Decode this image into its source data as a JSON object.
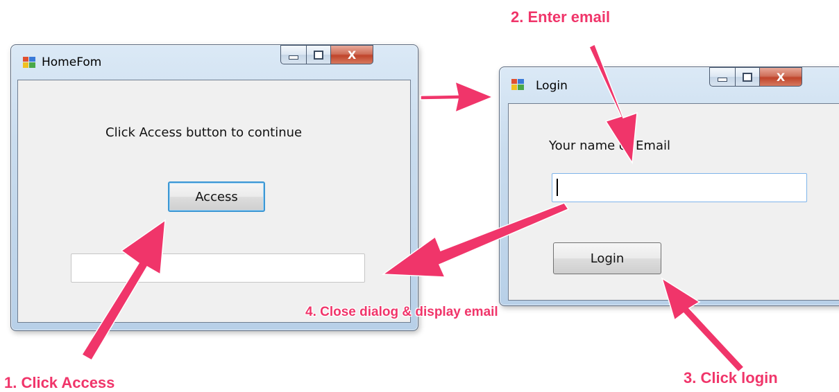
{
  "home_window": {
    "title": "HomeFom",
    "message": "Click Access button to continue",
    "access_button": "Access",
    "result_field_value": "",
    "close_glyph": "X"
  },
  "login_window": {
    "title": "Login",
    "prompt": "Your name or Email",
    "email_field_value": "",
    "login_button": "Login",
    "close_glyph": "X"
  },
  "annotations": {
    "step1": "1. Click Access",
    "step2": "2. Enter email",
    "step3": "3. Click login",
    "step4": "4. Close dialog & display email",
    "arrow_color": "#f0356a"
  }
}
